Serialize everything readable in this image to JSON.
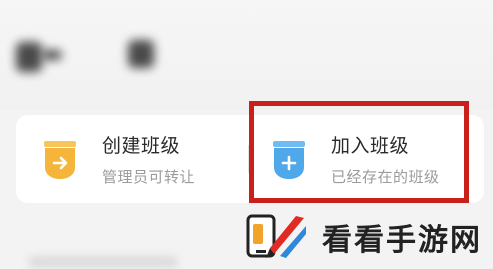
{
  "options": [
    {
      "title": "创建班级",
      "subtitle": "管理员可转让",
      "icon": "arrow-right-icon",
      "color": "#f5b53a"
    },
    {
      "title": "加入班级",
      "subtitle": "已经存在的班级",
      "icon": "plus-icon",
      "color": "#4ea8ea"
    }
  ],
  "highlight_color": "#c8201a",
  "watermark": {
    "text": "看看手游网"
  }
}
